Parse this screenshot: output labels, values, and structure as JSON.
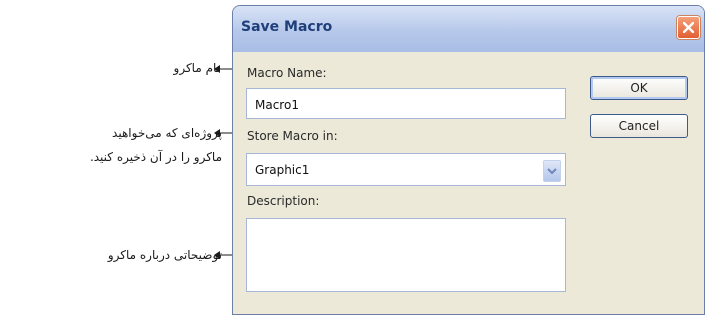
{
  "window": {
    "title": "Save Macro"
  },
  "form": {
    "macro_name_label": "Macro Name:",
    "macro_name_value": "Macro1",
    "store_in_label": "Store Macro in:",
    "store_in_value": "Graphic1",
    "description_label": "Description:",
    "description_value": ""
  },
  "buttons": {
    "ok": "OK",
    "cancel": "Cancel"
  },
  "annotations": {
    "macro_name": "نام ماکرو",
    "project_line1": "پروژه‌ای که می‌خواهید",
    "project_line2": "ماکرو را در آن ذخیره کنید.",
    "description": "توضیحاتی درباره ماکرو"
  },
  "icons": {
    "close": "close-x-icon",
    "dropdown": "chevron-down-icon"
  },
  "colors": {
    "titlebar": "#b6c8ea",
    "title_text": "#1f3e7a",
    "close": "#e25f32",
    "dialog_bg": "#ece9d8"
  }
}
